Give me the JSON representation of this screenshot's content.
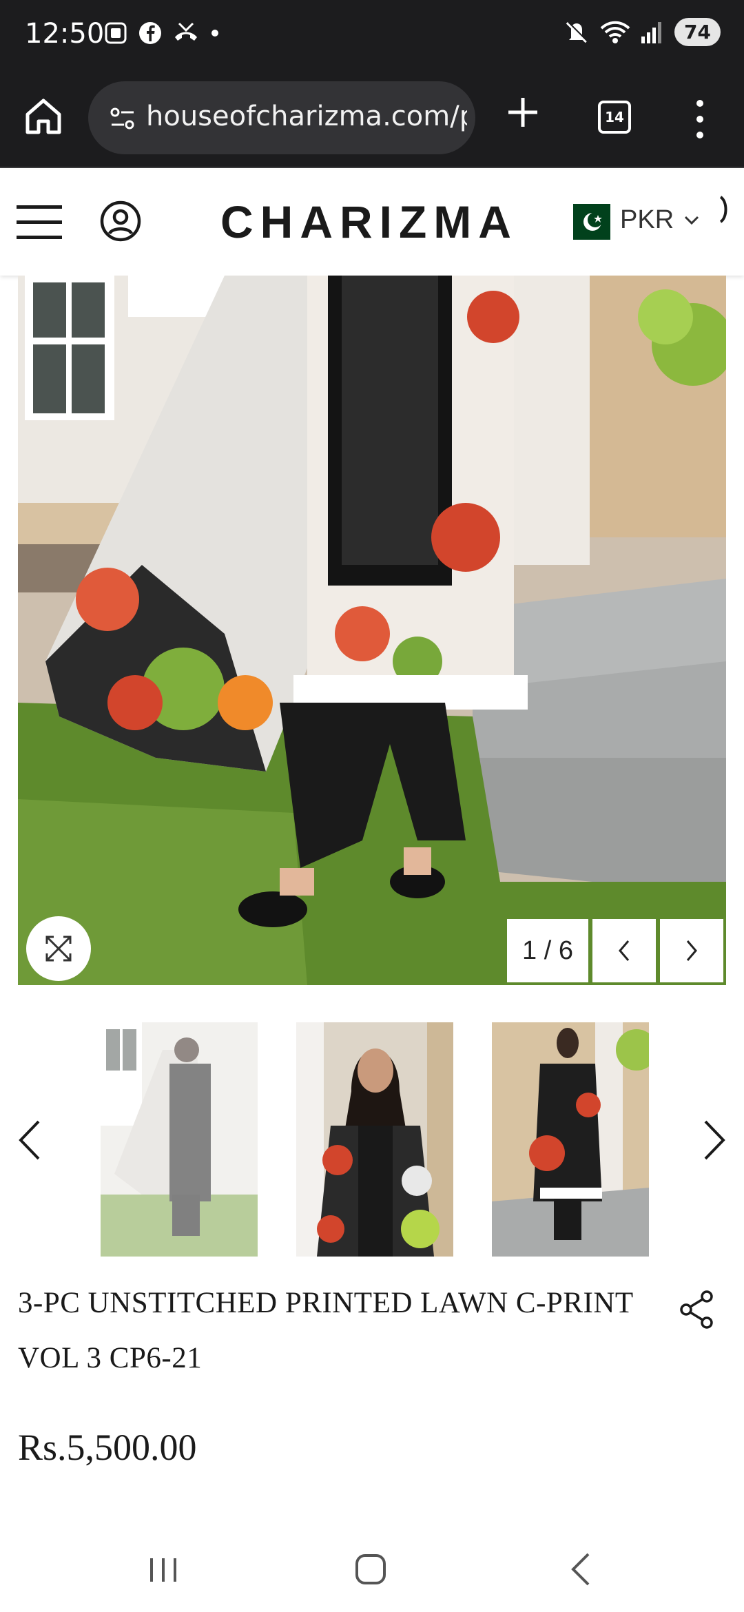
{
  "status_bar": {
    "time": "12:50",
    "battery": "74",
    "icons": [
      "screenshot-icon",
      "facebook-icon",
      "missed-call-icon",
      "dot-icon",
      "mute-icon",
      "wifi-icon",
      "signal-icon"
    ]
  },
  "browser": {
    "url": "houseofcharizma.com/p",
    "tab_count": "14"
  },
  "site": {
    "brand": "CHARIZMA",
    "currency": "PKR"
  },
  "gallery": {
    "counter": "1 / 6"
  },
  "product": {
    "title": "3-PC UNSTITCHED PRINTED LAWN C-PRINT VOL 3 CP6-21",
    "price": "Rs.5,500.00"
  },
  "colors": {
    "browser_chrome": "#1c1c1e",
    "url_pill": "#333336",
    "flag_green": "#01411c",
    "text_dark": "#1a1a1a"
  }
}
